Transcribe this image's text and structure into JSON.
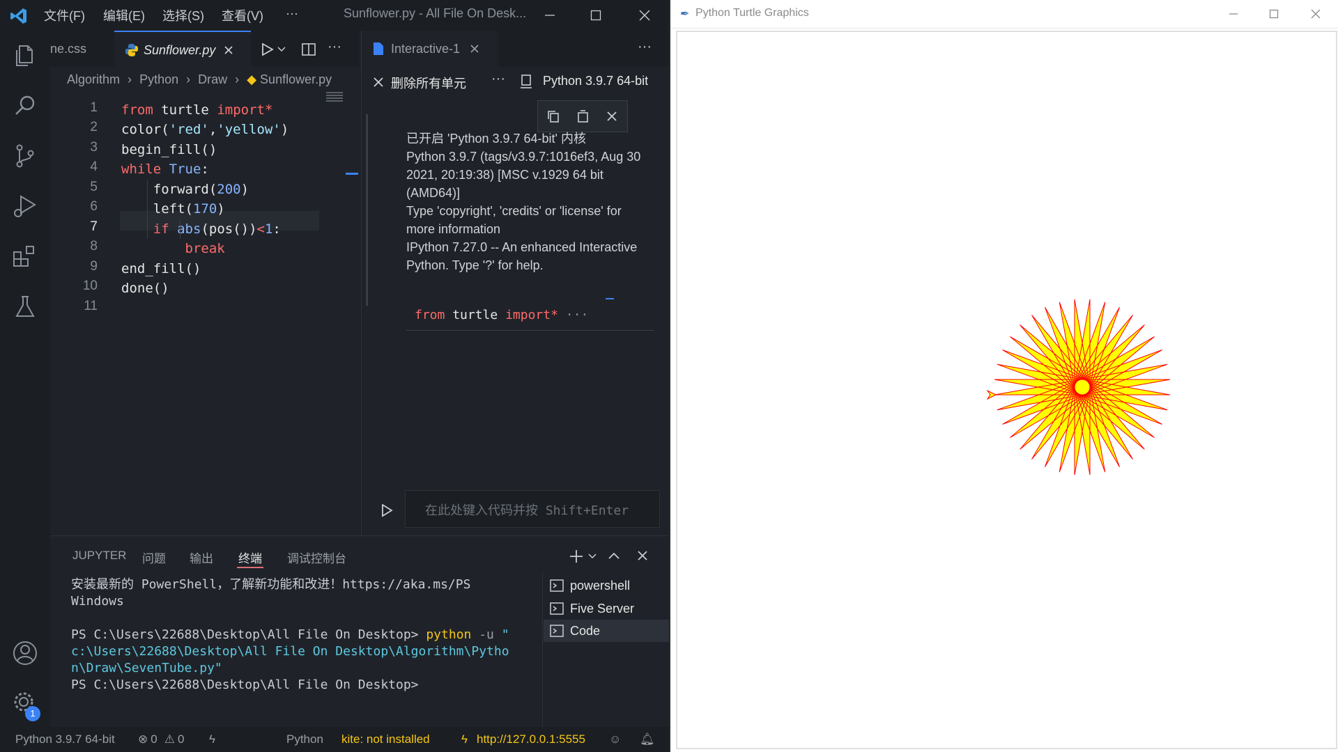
{
  "vscode": {
    "menu": [
      "文件(F)",
      "编辑(E)",
      "选择(S)",
      "查看(V)",
      "···"
    ],
    "window_title": "Sunflower.py - All File On Desk...",
    "tabs": [
      {
        "label": "ne.css"
      },
      {
        "label": "Sunflower.py"
      }
    ],
    "breadcrumb": [
      "Algorithm",
      "Python",
      "Draw",
      "Sunflower.py"
    ],
    "code_lines": [
      "from turtle import*",
      "color('red','yellow')",
      "begin_fill()",
      "while True:",
      "    forward(200)",
      "    left(170)",
      "    if abs(pos())<1:",
      "        break",
      "end_fill()",
      "done()",
      ""
    ],
    "line_numbers": [
      "1",
      "2",
      "3",
      "4",
      "5",
      "6",
      "7",
      "8",
      "9",
      "10",
      "11"
    ],
    "interactive": {
      "tab_label": "Interactive-1",
      "clear_all": "删除所有单元",
      "kernel": "Python 3.9.7 64-bit",
      "output": [
        "已开启 'Python 3.9.7 64-bit' 内核",
        "Python 3.9.7 (tags/v3.9.7:1016ef3, Aug 30",
        "2021, 20:19:38) [MSC v.1929 64 bit",
        "(AMD64)]",
        "Type 'copyright', 'credits' or 'license' for",
        "more information",
        "IPython 7.27.0 -- An enhanced Interactive",
        "Python. Type '?' for help."
      ],
      "cell_preview": "from turtle import* ···",
      "input_placeholder": "在此处键入代码并按 Shift+Enter"
    },
    "panel": {
      "tabs": [
        "JUPYTER",
        "问题",
        "输出",
        "终端",
        "调试控制台"
      ],
      "active_tab": "终端",
      "terminal_lines": [
        "安装最新的 PowerShell，了解新功能和改进！https://aka.ms/PS",
        "Windows",
        "",
        "PS C:\\Users\\22688\\Desktop\\All File On Desktop> python -u \"",
        "c:\\Users\\22688\\Desktop\\All File On Desktop\\Algorithm\\Pytho",
        "n\\Draw\\SevenTube.py\"",
        "PS C:\\Users\\22688\\Desktop\\All File On Desktop>"
      ],
      "terminals": [
        "powershell",
        "Five Server",
        "Code"
      ]
    },
    "statusbar": {
      "interpreter": "Python 3.9.7 64-bit",
      "errors": "0",
      "warnings": "0",
      "language": "Python",
      "kite": "kite: not installed",
      "server": "http://127.0.0.1:5555"
    },
    "badge_count": "1"
  },
  "turtle": {
    "title": "Python Turtle Graphics",
    "fill_color": "#ffff00",
    "pen_color": "#ff0000"
  }
}
